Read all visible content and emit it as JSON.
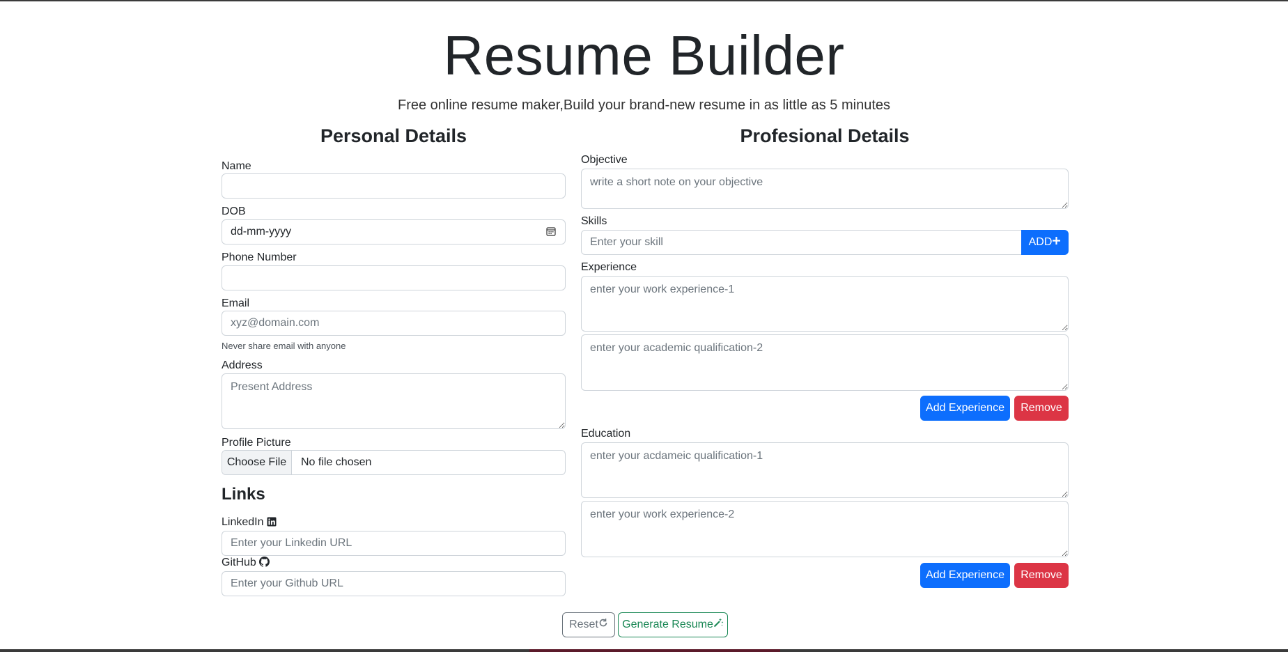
{
  "header": {
    "title": "Resume Builder",
    "subtitle": "Free online resume maker,Build your brand-new resume in as little as 5 minutes"
  },
  "personal": {
    "heading": "Personal Details",
    "name_label": "Name",
    "name_value": "",
    "dob_label": "DOB",
    "dob_value": "dd-mm-yyyy",
    "phone_label": "Phone Number",
    "phone_value": "",
    "email_label": "Email",
    "email_placeholder": "xyz@domain.com",
    "email_help": "Never share email with anyone",
    "address_label": "Address",
    "address_placeholder": "Present Address",
    "picture_label": "Profile Picture",
    "file_button": "Choose File",
    "file_status": "No file chosen"
  },
  "links": {
    "heading": "Links",
    "linkedin_label": "LinkedIn",
    "linkedin_placeholder": "Enter your Linkedin URL",
    "github_label": "GitHub",
    "github_placeholder": "Enter your Github URL"
  },
  "professional": {
    "heading": "Profesional Details",
    "objective_label": "Objective",
    "objective_placeholder": "write a short note on your objective",
    "skills_label": "Skills",
    "skills_placeholder": "Enter your skill",
    "add_skill_label": "ADD",
    "experience_label": "Experience",
    "experience_1_placeholder": "enter your work experience-1",
    "experience_2_placeholder": "enter your academic qualification-2",
    "add_experience_label": "Add Experience",
    "remove_experience_label": "Remove",
    "education_label": "Education",
    "education_1_placeholder": "enter your acdameic qualification-1",
    "education_2_placeholder": "enter your work experience-2",
    "add_education_label": "Add Experience",
    "remove_education_label": "Remove"
  },
  "actions": {
    "reset_label": "Reset",
    "generate_label": "Generate Resume"
  },
  "colors": {
    "primary": "#0d6efd",
    "danger": "#dc3545",
    "success": "#198754",
    "secondary": "#6c757d",
    "border": "#ced4da"
  },
  "icons": {
    "calendar": "calendar-icon",
    "plus": "plus-icon",
    "linkedin": "linkedin-icon",
    "github": "github-icon",
    "reset": "refresh-icon",
    "generate": "magic-wand-icon"
  }
}
